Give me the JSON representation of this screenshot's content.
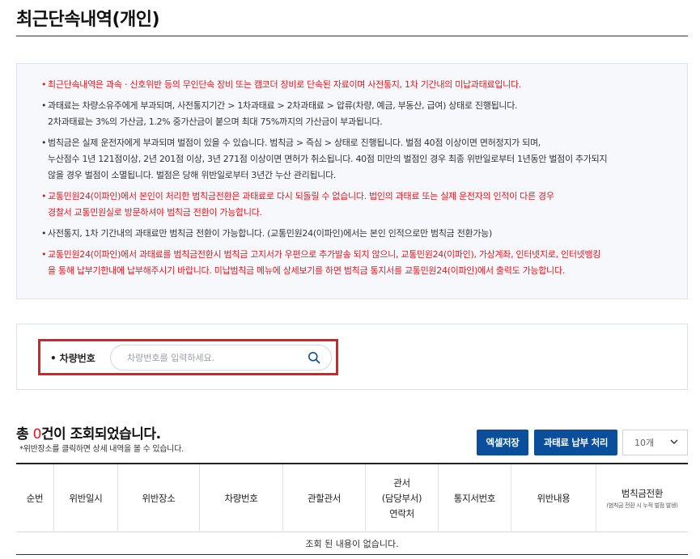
{
  "page": {
    "title": "최근단속내역(개인)"
  },
  "notice": {
    "items": [
      {
        "text": "최근단속내역은 과속ㆍ신호위반 등의 무인단속 장비 또는 캠코더 장비로 단속된 자료이며 사전통지, 1차 기간내의 미납과태료입니다.",
        "color": "#e0191f"
      },
      {
        "text": "과태료는 차량소유주에게 부과되며, 사전통지기간 > 1차과태료 > 2차과태료 > 압류(차량, 예금, 부동산, 급여) 상태로 진행됩니다.\n2차과태료는 3%의 가산금, 1.2% 중가산금이 붙으며 최대 75%까지의 가산금이 부과됩니다.",
        "color": "#333333"
      },
      {
        "text": "범칙금은 실제 운전자에게 부과되며 벌점이 있을 수 있습니다. 범칙금 > 즉심 > 상태로 진행됩니다. 벌점 40점 이상이면 면허정지가 되며,\n누산점수 1년 121점이상, 2년 201점 이상, 3년 271점 이상이면 면허가 취소됩니다. 40점 미만의 벌점인 경우 최종 위반일로부터 1년동안 벌점이 추가되지\n않을 경우 벌점이 소멸됩니다. 벌점은 당해 위반일로부터 3년간 누산 관리됩니다.",
        "color": "#333333"
      },
      {
        "text": "교통민원24(이파인)에서 본인이 처리한 범칙금전환은 과태료로 다시 되돌릴 수 없습니다. 법인의 과태료 또는 실제 운전자의 인적이 다른 경우\n경찰서 교통민원실로 방문하셔야 범칙금 전환이 가능합니다.",
        "color": "#e0191f"
      },
      {
        "text": "사전통지, 1차 기간내의 과태료만 범칙금 전환이 가능합니다. (교통민원24(이파인)에서는 본인 인적으로만 범칙금 전환가능)",
        "color": "#333333"
      },
      {
        "text": "교통민원24(이파인)에서 과태료를 범칙금전환시 범칙금 고지서가 우편으로 추가발송 되지 않으니, 교통민원24(이파인), 가상계좌, 인터넷지로, 인터넷뱅킹\n을 통해 납부기한내에 납부해주시기 바랍니다. 미납범칙금 메뉴에 상세보기를 하면 범칙금 통지서를 교통민원24(이파인)에서 출력도 가능합니다.",
        "color": "#e0191f"
      }
    ]
  },
  "search": {
    "label": "차량번호",
    "placeholder": "차량번호를 입력하세요.",
    "value": "",
    "icon": "search-icon",
    "highlight_color": "#e02020"
  },
  "results": {
    "prefix": "총 ",
    "count": "0",
    "suffix": "건이 조회되었습니다.",
    "hint": "*위반장소를 클릭하면 상세 내역을 볼 수 있습니다.",
    "excel_button": "엑셀저장",
    "pay_button": "과태료 납부 처리",
    "page_size": "10개",
    "accent_color": "#0b4f9c"
  },
  "table": {
    "columns": [
      {
        "label": "순번"
      },
      {
        "label": "위반일시"
      },
      {
        "label": "위반장소"
      },
      {
        "label": "차량번호"
      },
      {
        "label": "관할관서"
      },
      {
        "label": "관서\n(담당부서)\n연락처"
      },
      {
        "label": "통지서번호"
      },
      {
        "label": "위반내용"
      },
      {
        "label": "범칙금전환",
        "sub": "(범칙금 전환 시 누적 벌점 발생)"
      }
    ],
    "empty_message": "조회 된 내용이 없습니다."
  }
}
